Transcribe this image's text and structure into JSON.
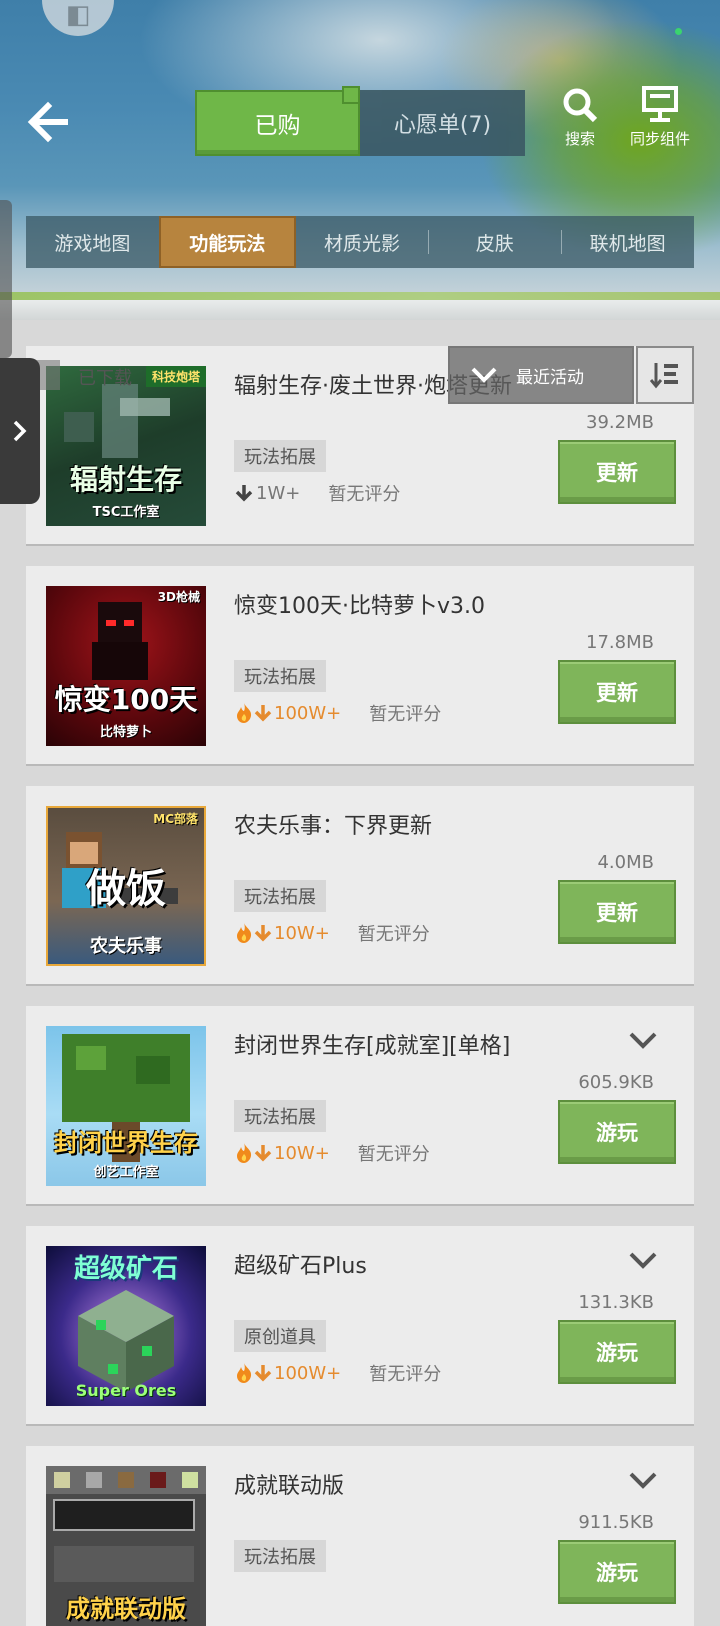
{
  "header": {
    "back_icon": "back-arrow-icon",
    "tab_bought": "已购",
    "tab_wishlist": "心愿单(7)",
    "search_label": "搜索",
    "sync_label": "同步组件"
  },
  "categories": [
    {
      "label": "游戏地图",
      "active": false
    },
    {
      "label": "功能玩法",
      "active": true
    },
    {
      "label": "材质光影",
      "active": false
    },
    {
      "label": "皮肤",
      "active": false
    },
    {
      "label": "联机地图",
      "active": false
    }
  ],
  "filter": {
    "downloaded_label": "已下载",
    "sort_label": "最近活动"
  },
  "items": [
    {
      "title": "辐射生存·废土世界·炮塔更新",
      "size": "39.2MB",
      "tag": "玩法拓展",
      "downloads": "1W+",
      "rating": "暂无评分",
      "action": "更新",
      "thumb_big": "辐射生存",
      "thumb_small": "TSC工作室",
      "thumb_corner": "科技炮塔"
    },
    {
      "title": "惊变100天·比特萝卜v3.0",
      "size": "17.8MB",
      "tag": "玩法拓展",
      "downloads": "100W+",
      "rating": "暂无评分",
      "action": "更新",
      "thumb_big": "惊变100天",
      "thumb_small": "比特萝卜",
      "thumb_corner": "3D枪械"
    },
    {
      "title": "农夫乐事：下界更新",
      "size": "4.0MB",
      "tag": "玩法拓展",
      "downloads": "10W+",
      "rating": "暂无评分",
      "action": "更新",
      "thumb_big": "做饭",
      "thumb_small": "农夫乐事",
      "thumb_corner": "MC部落"
    },
    {
      "title": "封闭世界生存[成就室][单格]",
      "size": "605.9KB",
      "tag": "玩法拓展",
      "downloads": "10W+",
      "rating": "暂无评分",
      "action": "游玩",
      "thumb_big": "封闭世界生存",
      "thumb_small": "创艺工作室",
      "thumb_corner": ""
    },
    {
      "title": "超级矿石Plus",
      "size": "131.3KB",
      "tag": "原创道具",
      "downloads": "100W+",
      "rating": "暂无评分",
      "action": "游玩",
      "thumb_big": "超级矿石",
      "thumb_small": "Super Ores",
      "thumb_corner": ""
    },
    {
      "title": "成就联动版",
      "size": "911.5KB",
      "tag": "玩法拓展",
      "downloads": "",
      "rating": "",
      "action": "游玩",
      "thumb_big": "成就联动版",
      "thumb_small": "",
      "thumb_corner": ""
    }
  ],
  "colors": {
    "accent_green": "#7fb55a",
    "tab_active_gold": "#b7843e",
    "hot_orange": "#e58b2e"
  }
}
